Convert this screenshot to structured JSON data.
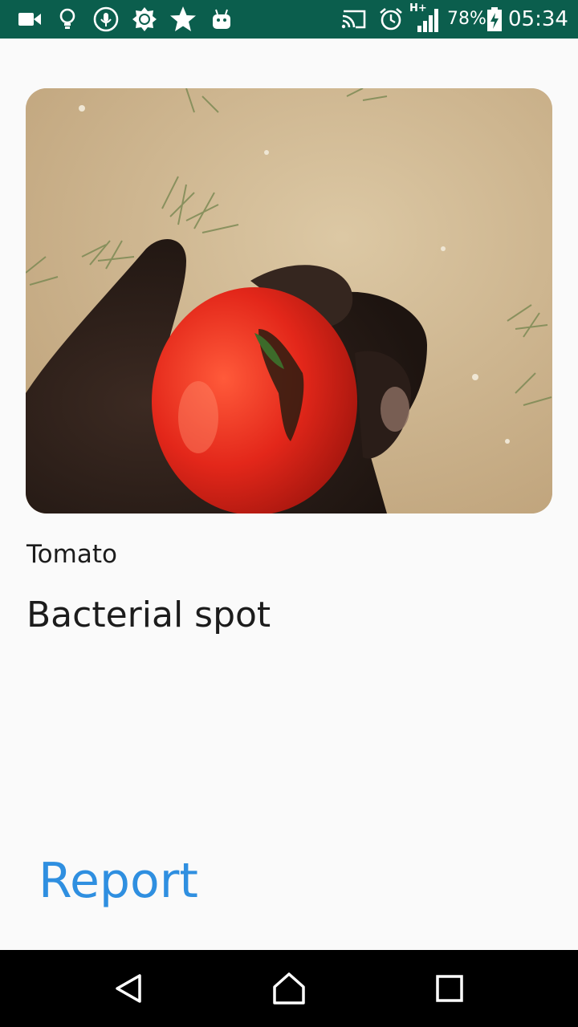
{
  "status_bar": {
    "icons_left": [
      "video-camera-icon",
      "lightbulb-icon",
      "microphone-icon",
      "brightness-icon",
      "star-icon",
      "android-icon"
    ],
    "icons_right": [
      "cast-icon",
      "alarm-icon",
      "signal-icon",
      "battery-charging-icon"
    ],
    "network_type": "H+",
    "battery_percent": "78%",
    "time": "05:34",
    "background_color": "#0b5e4d"
  },
  "result": {
    "image_icon": "tomato-photo",
    "crop": "Tomato",
    "disease": "Bacterial spot"
  },
  "actions": {
    "report_label": "Report",
    "accent_color": "#2f8fe0"
  },
  "nav_bar": {
    "buttons": [
      "back-icon",
      "home-icon",
      "recents-icon"
    ]
  }
}
